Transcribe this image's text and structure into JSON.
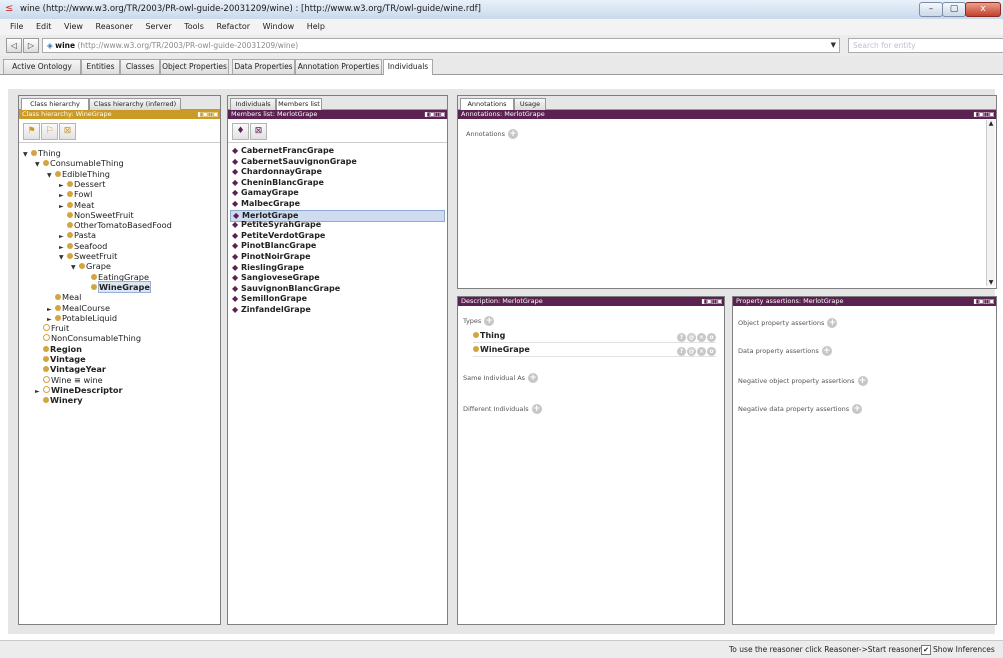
{
  "window": {
    "title": "wine (http://www.w3.org/TR/2003/PR-owl-guide-20031209/wine)  : [http://www.w3.org/TR/owl-guide/wine.rdf]",
    "min": "–",
    "max": "▢",
    "close": "x"
  },
  "menu": [
    "File",
    "Edit",
    "View",
    "Reasoner",
    "Server",
    "Tools",
    "Refactor",
    "Window",
    "Help"
  ],
  "address": {
    "name": "wine",
    "url": "(http://www.w3.org/TR/2003/PR-owl-guide-20031209/wine)",
    "search_placeholder": "Search for entity"
  },
  "tabs": [
    "Active Ontology",
    "Entities",
    "Classes",
    "Object Properties",
    "Data Properties",
    "Annotation Properties",
    "Individuals"
  ],
  "class_panel": {
    "tabs": [
      "Class hierarchy",
      "Class hierarchy (inferred)"
    ],
    "header": "Class hierarchy: WineGrape",
    "tree": [
      {
        "label": "Thing",
        "level": 0,
        "toggle": "▼",
        "bold": false
      },
      {
        "label": "ConsumableThing",
        "level": 1,
        "toggle": "▼",
        "bold": false
      },
      {
        "label": "EdibleThing",
        "level": 2,
        "toggle": "▼",
        "bold": false
      },
      {
        "label": "Dessert",
        "level": 3,
        "toggle": "►",
        "bold": false
      },
      {
        "label": "Fowl",
        "level": 3,
        "toggle": "►",
        "bold": false
      },
      {
        "label": "Meat",
        "level": 3,
        "toggle": "►",
        "bold": false
      },
      {
        "label": "NonSweetFruit",
        "level": 3,
        "toggle": "",
        "bold": false
      },
      {
        "label": "OtherTomatoBasedFood",
        "level": 3,
        "toggle": "",
        "bold": false
      },
      {
        "label": "Pasta",
        "level": 3,
        "toggle": "►",
        "bold": false
      },
      {
        "label": "Seafood",
        "level": 3,
        "toggle": "►",
        "bold": false
      },
      {
        "label": "SweetFruit",
        "level": 3,
        "toggle": "▼",
        "bold": false
      },
      {
        "label": "Grape",
        "level": 4,
        "toggle": "▼",
        "bold": false
      },
      {
        "label": "EatingGrape",
        "level": 5,
        "toggle": "",
        "bold": false
      },
      {
        "label": "WineGrape",
        "level": 5,
        "toggle": "",
        "bold": true,
        "selected": true
      },
      {
        "label": "Meal",
        "level": 2,
        "toggle": "",
        "bold": false
      },
      {
        "label": "MealCourse",
        "level": 2,
        "toggle": "►",
        "bold": false
      },
      {
        "label": "PotableLiquid",
        "level": 2,
        "toggle": "►",
        "bold": false
      },
      {
        "label": "Fruit",
        "level": 1,
        "toggle": "",
        "bold": false,
        "open": true
      },
      {
        "label": "NonConsumableThing",
        "level": 1,
        "toggle": "",
        "bold": false,
        "open": true
      },
      {
        "label": "Region",
        "level": 1,
        "toggle": "",
        "bold": true
      },
      {
        "label": "Vintage",
        "level": 1,
        "toggle": "",
        "bold": true
      },
      {
        "label": "VintageYear",
        "level": 1,
        "toggle": "",
        "bold": true
      },
      {
        "label": "Wine ≡ wine",
        "level": 1,
        "toggle": "",
        "bold": false,
        "open": true
      },
      {
        "label": "WineDescriptor",
        "level": 1,
        "toggle": "►",
        "bold": true,
        "open": true
      },
      {
        "label": "Winery",
        "level": 1,
        "toggle": "",
        "bold": true
      }
    ]
  },
  "members_panel": {
    "tabs": [
      "Individuals",
      "Members list"
    ],
    "header": "Members list: MerlotGrape",
    "items": [
      "CabernetFrancGrape",
      "CabernetSauvignonGrape",
      "ChardonnayGrape",
      "CheninBlancGrape",
      "GamayGrape",
      "MalbecGrape",
      "MerlotGrape",
      "PetiteSyrahGrape",
      "PetiteVerdotGrape",
      "PinotBlancGrape",
      "PinotNoirGrape",
      "RieslingGrape",
      "SangioveseGrape",
      "SauvignonBlancGrape",
      "SemillonGrape",
      "ZinfandelGrape"
    ],
    "selected": "MerlotGrape"
  },
  "annotations_panel": {
    "tabs": [
      "Annotations",
      "Usage"
    ],
    "header": "Annotations: MerlotGrape",
    "label": "Annotations"
  },
  "description_panel": {
    "header": "Description: MerlotGrape",
    "types_label": "Types",
    "types": [
      "Thing",
      "WineGrape"
    ],
    "same_label": "Same Individual As",
    "different_label": "Different Individuals"
  },
  "assertions_panel": {
    "header": "Property assertions: MerlotGrape",
    "labels": [
      "Object property assertions",
      "Data property assertions",
      "Negative object property assertions",
      "Negative data property assertions"
    ]
  },
  "status": {
    "message": "To use the reasoner click Reasoner->Start reasoner",
    "show_inferences": "Show Inferences"
  },
  "colors": {
    "gold_header": "#c99a25",
    "purple_header": "#5b2151",
    "class_dot": "#d4a440"
  }
}
